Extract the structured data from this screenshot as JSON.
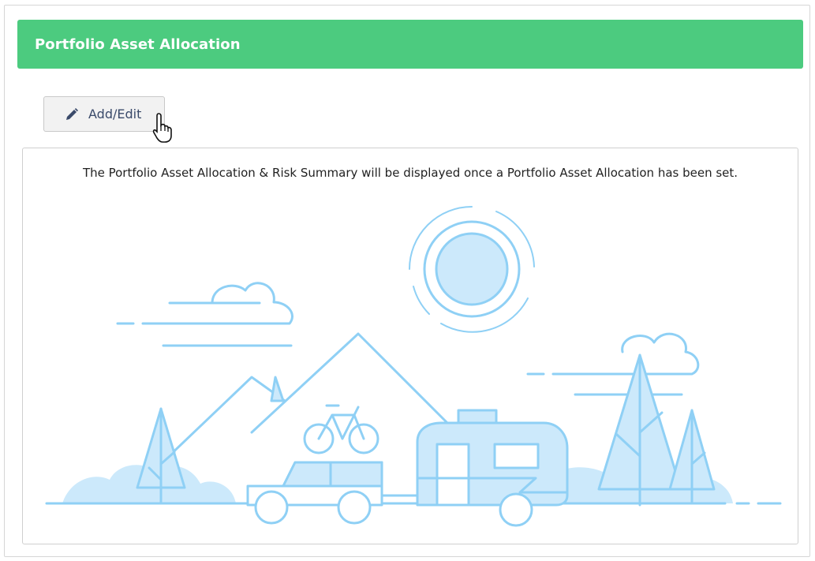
{
  "panel": {
    "title": "Portfolio Asset Allocation"
  },
  "toolbar": {
    "edit_label": "Add/Edit",
    "edit_icon": "pencil-icon"
  },
  "content": {
    "message": "The Portfolio Asset Allocation & Risk Summary will be displayed once a Portfolio Asset Allocation has been set.",
    "illustration": "camping-trailer-scene"
  },
  "colors": {
    "header_bg": "#4ccb7f",
    "illustration_line": "#8fd0f5",
    "illustration_fill": "#cce9fb"
  }
}
